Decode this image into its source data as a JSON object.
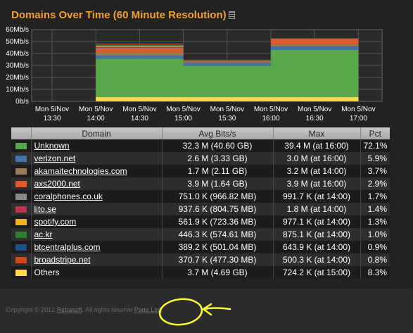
{
  "title": "Domains Over Time (60 Minute Resolution)",
  "chart_data": {
    "type": "area",
    "stacked": true,
    "ylabels": [
      "60Mb/s",
      "50Mb/s",
      "40Mb/s",
      "30Mb/s",
      "20Mb/s",
      "10Mb/s",
      "0b/s"
    ],
    "ylim": [
      0,
      60
    ],
    "yunit": "Mb/s",
    "x_ticks": [
      "Mon 5/Nov 13:30",
      "Mon 5/Nov 14:00",
      "Mon 5/Nov 14:30",
      "Mon 5/Nov 15:00",
      "Mon 5/Nov 15:30",
      "Mon 5/Nov 16:00",
      "Mon 5/Nov 16:30",
      "Mon 5/Nov 17:00"
    ],
    "grid": true,
    "buckets": [
      {
        "start": "14:00",
        "end": "15:00"
      },
      {
        "start": "15:00",
        "end": "16:00"
      },
      {
        "start": "16:00",
        "end": "17:00"
      }
    ],
    "series": [
      {
        "name": "Others",
        "color": "#ffd84a",
        "values": [
          3.7,
          3.7,
          3.7
        ]
      },
      {
        "name": "Unknown",
        "color": "#5aa64a",
        "values": [
          32,
          26,
          39.4
        ]
      },
      {
        "name": "verizon.net",
        "color": "#3f74a8",
        "values": [
          2.6,
          2.4,
          3.0
        ]
      },
      {
        "name": "akamaitechnologies.com",
        "color": "#9a7a55",
        "values": [
          2.5,
          0.8,
          1.7
        ]
      },
      {
        "name": "axs2000.net",
        "color": "#e05a2a",
        "values": [
          2.8,
          0.5,
          4.2
        ]
      },
      {
        "name": "coralphones.co.uk",
        "color": "#8a8a8a",
        "values": [
          1.0,
          0.4,
          0.3
        ]
      },
      {
        "name": "lito.se",
        "color": "#c03050",
        "values": [
          1.0,
          0.3,
          0.1
        ]
      },
      {
        "name": "spotify.com",
        "color": "#f0b020",
        "values": [
          0.8,
          0.2,
          0.1
        ]
      },
      {
        "name": "ac.kr",
        "color": "#2e7d32",
        "values": [
          0.8,
          0.2,
          0.1
        ]
      },
      {
        "name": "btcentralplus.com",
        "color": "#1f4e8c",
        "values": [
          0.6,
          0.2,
          0.1
        ]
      },
      {
        "name": "broadstripe.net",
        "color": "#cc4a10",
        "values": [
          0.5,
          0.1,
          0.1
        ]
      }
    ]
  },
  "table": {
    "headers": [
      "",
      "Domain",
      "Avg Bits/s",
      "Max",
      "Pct"
    ],
    "rows": [
      {
        "color": "#5aa64a",
        "domain": "Unknown",
        "avg": "32.3 M (40.60 GB)",
        "max": "39.4 M (at 16:00)",
        "pct": "72.1%"
      },
      {
        "color": "#3f74a8",
        "domain": "verizon.net",
        "avg": "2.6 M (3.33 GB)",
        "max": "3.0 M (at 16:00)",
        "pct": "5.9%"
      },
      {
        "color": "#9a7a55",
        "domain": "akamaitechnologies.com",
        "avg": "1.7 M (2.11 GB)",
        "max": "3.2 M (at 14:00)",
        "pct": "3.7%"
      },
      {
        "color": "#e05a2a",
        "domain": "axs2000.net",
        "avg": "3.9 M (1.64 GB)",
        "max": "3.9 M (at 16:00)",
        "pct": "2.9%"
      },
      {
        "color": "#8a8a8a",
        "domain": "coralphones.co.uk",
        "avg": "751.0 K (966.82 MB)",
        "max": "991.7 K (at 14:00)",
        "pct": "1.7%"
      },
      {
        "color": "#c03050",
        "domain": "lito.se",
        "avg": "937.6 K (804.75 MB)",
        "max": "1.8 M (at 14:00)",
        "pct": "1.4%"
      },
      {
        "color": "#f0b020",
        "domain": "spotify.com",
        "avg": "561.9 K (723.36 MB)",
        "max": "977.1 K (at 14:00)",
        "pct": "1.3%"
      },
      {
        "color": "#2e7d32",
        "domain": "ac.kr",
        "avg": "446.3 K (574.61 MB)",
        "max": "875.1 K (at 14:00)",
        "pct": "1.0%"
      },
      {
        "color": "#1f4e8c",
        "domain": "btcentralplus.com",
        "avg": "389.2 K (501.04 MB)",
        "max": "643.9 K (at 14:00)",
        "pct": "0.9%"
      },
      {
        "color": "#cc4a10",
        "domain": "broadstripe.net",
        "avg": "370.7 K (477.30 MB)",
        "max": "500.3 K (at 14:00)",
        "pct": "0.8%"
      },
      {
        "color": "#ffd84a",
        "domain": "Others",
        "avg": "3.7 M (4.69 GB)",
        "max": "724.2 K (at 15:00)",
        "pct": "8.3%"
      }
    ]
  },
  "footer": {
    "copyright": "Copyright © 2012",
    "company_link": "Rebasoft",
    "rights": ". All rights reserve",
    "page_link": "Page Link"
  },
  "annotation": {
    "color": "#ffff33"
  }
}
